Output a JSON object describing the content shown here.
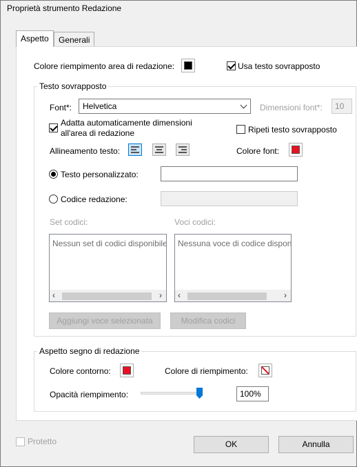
{
  "window": {
    "title": "Proprietà strumento Redazione"
  },
  "tabs": [
    {
      "label": "Aspetto",
      "active": true
    },
    {
      "label": "Generali",
      "active": false
    }
  ],
  "fill_color": {
    "label": "Colore riempimento area di redazione:",
    "color": "#000000"
  },
  "use_overlay": {
    "label": "Usa testo sovrapposto",
    "checked": true
  },
  "overlay_group": {
    "legend": "Testo sovrapposto",
    "font_label": "Font*:",
    "font_value": "Helvetica",
    "font_size_label": "Dimensioni font*:",
    "font_size_value": "10",
    "autosize_label_line1": "Adatta automaticamente dimensioni",
    "autosize_label_line2": "all'area di redazione",
    "autosize_checked": true,
    "repeat_label": "Ripeti testo sovrapposto",
    "repeat_checked": false,
    "alignment_label": "Allineamento testo:",
    "alignment_selected": "left",
    "font_color_label": "Colore font:",
    "font_color": "#e81123",
    "custom_text_label": "Testo personalizzato:",
    "custom_text_value": "",
    "custom_text_selected": true,
    "redaction_code_label": "Codice redazione:",
    "redaction_code_value": "",
    "code_sets_label": "Set codici:",
    "code_sets_empty": "Nessun set di codici disponibile",
    "code_entries_label": "Voci codici:",
    "code_entries_empty": "Nessuna voce di codice disponibile",
    "add_selected_button": "Aggiungi voce selezionata",
    "edit_codes_button": "Modifica codici"
  },
  "appearance_group": {
    "legend": "Aspetto segno di redazione",
    "outline_label": "Colore contorno:",
    "outline_color": "#e81123",
    "fill_label": "Colore di riempimento:",
    "fill_color": "none",
    "opacity_label": "Opacità riempimento:",
    "opacity_value": "100%",
    "opacity_fraction": 1.0
  },
  "protected": {
    "label": "Protetto",
    "checked": false
  },
  "buttons": {
    "ok": "OK",
    "cancel": "Annulla"
  },
  "icons": [
    "chevron-down-icon",
    "align-left-icon",
    "align-center-icon",
    "align-right-icon",
    "chevron-left-icon",
    "chevron-right-icon",
    "no-color-icon"
  ]
}
